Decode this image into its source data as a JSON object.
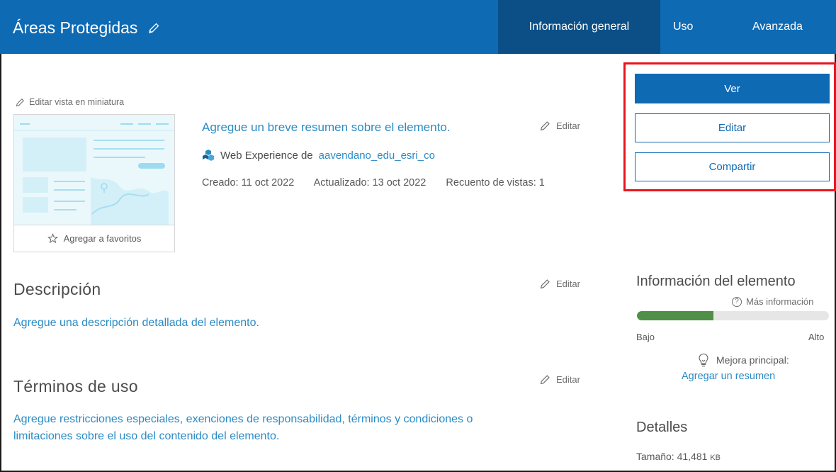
{
  "header": {
    "title": "Áreas Protegidas",
    "tabs": [
      {
        "label": "Información general",
        "active": true
      },
      {
        "label": "Uso",
        "active": false
      },
      {
        "label": "Avanzada",
        "active": false
      }
    ],
    "colors": {
      "brand": "#0f6ab4",
      "active_tab": "#0b4f86"
    }
  },
  "thumbnail": {
    "edit_label": "Editar vista en miniatura",
    "favorite_label": "Agregar a favoritos"
  },
  "summary": {
    "placeholder_link": "Agregue un breve resumen sobre el elemento.",
    "edit_label": "Editar",
    "type_prefix": "Web Experience de",
    "owner": "aavendano_edu_esri_co",
    "created": "Creado: 11 oct 2022",
    "updated": "Actualizado: 13 oct 2022",
    "views": "Recuento de vistas: 1"
  },
  "actions": {
    "view": "Ver",
    "edit": "Editar",
    "share": "Compartir",
    "highlight_color": "#e8151d"
  },
  "description": {
    "title": "Descripción",
    "edit_label": "Editar",
    "placeholder": "Agregue una descripción detallada del elemento."
  },
  "terms": {
    "title": "Términos de uso",
    "edit_label": "Editar",
    "placeholder_line1": "Agregue restricciones especiales, exenciones de responsabilidad, términos y condiciones o",
    "placeholder_line2": "limitaciones sobre el uso del contenido del elemento."
  },
  "item_info": {
    "title": "Información del elemento",
    "more_info": "Más información",
    "score_fraction": 0.4,
    "low_label": "Bajo",
    "high_label": "Alto",
    "tip_label": "Mejora principal:",
    "tip_action": "Agregar un resumen",
    "meter_color": "#4f8f47"
  },
  "details": {
    "title": "Detalles",
    "size_label": "Tamaño: 41,481",
    "size_unit": "KB"
  }
}
